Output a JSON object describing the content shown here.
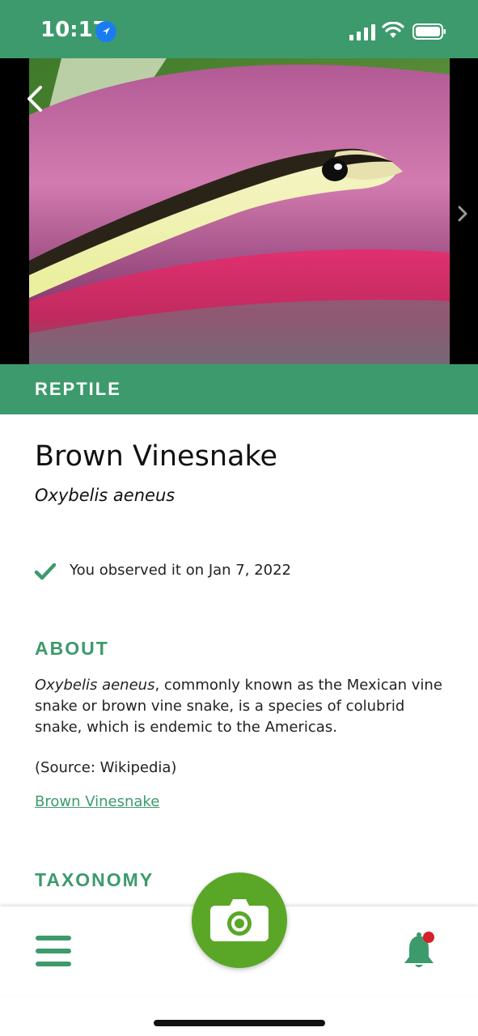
{
  "status_bar": {
    "time": "10:17"
  },
  "hero": {
    "category": "REPTILE"
  },
  "species": {
    "common_name": "Brown Vinesnake",
    "scientific_name": "Oxybelis aeneus",
    "observed_text": "You observed it on Jan 7, 2022"
  },
  "about": {
    "heading": "ABOUT",
    "italic_lead": "Oxybelis aeneus",
    "body": ", commonly known as the Mexican vine snake or brown vine snake, is a species of colubrid snake, which is endemic to the Americas.",
    "source": "(Source: Wikipedia)",
    "link_label": "Brown Vinesnake"
  },
  "taxonomy": {
    "heading": "TAXONOMY"
  },
  "colors": {
    "brand_green": "#3d9a6c",
    "camera_green": "#5aa728",
    "notification_dot": "#d7202a"
  },
  "icons": [
    "location-arrow-icon",
    "signal-icon",
    "wifi-icon",
    "battery-icon",
    "back-chevron-icon",
    "next-chevron-icon",
    "checkmark-icon",
    "menu-icon",
    "camera-icon",
    "bell-icon"
  ]
}
